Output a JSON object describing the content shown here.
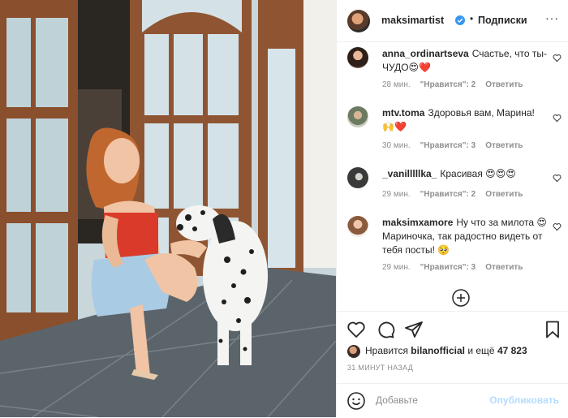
{
  "header": {
    "username": "maksimartist",
    "separator": "•",
    "follow_label": "Подписки",
    "more": "···"
  },
  "comments": [
    {
      "username": "anna_ordinartseva",
      "text": "Счастье, что ты- ЧУДО😍❤️",
      "time": "28 мин.",
      "likes": "\"Нравится\": 2",
      "reply": "Ответить"
    },
    {
      "username": "mtv.toma",
      "text": "Здоровья вам, Марина! 🙌❤️",
      "time": "30 мин.",
      "likes": "\"Нравится\": 3",
      "reply": "Ответить"
    },
    {
      "username": "_vanilllllka_",
      "text": "Красивая 😍😍😍",
      "time": "29 мин.",
      "likes": "\"Нравится\": 2",
      "reply": "Ответить"
    },
    {
      "username": "maksimxamore",
      "text": "Ну что за милота 😍 Мариночка, так радостно видеть от тебя посты! 🥺",
      "time": "29 мин.",
      "likes": "\"Нравится\": 3",
      "reply": "Ответить"
    }
  ],
  "likes": {
    "prefix": "Нравится",
    "user": "bilanofficial",
    "middle": "и ещё",
    "count": "47 823"
  },
  "timestamp": "31 МИНУТ НАЗАД",
  "composer": {
    "placeholder": "Добавьте",
    "publish_label": "Опубликовать"
  },
  "colors": {
    "verified": "#3897f0",
    "link_disabled": "#b3dbff",
    "muted": "#8e8e8e",
    "heart": "#ed4956"
  }
}
